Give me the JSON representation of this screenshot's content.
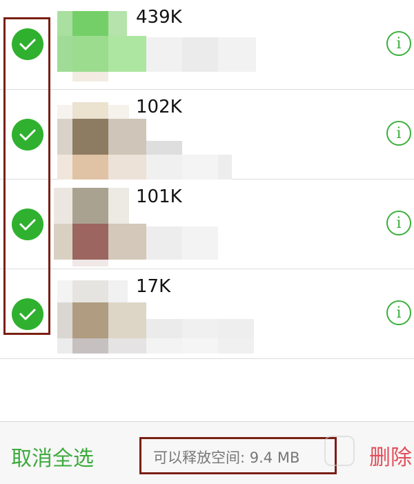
{
  "items": [
    {
      "size": "439K",
      "checked": true
    },
    {
      "size": "102K",
      "checked": true
    },
    {
      "size": "101K",
      "checked": true
    },
    {
      "size": "17K",
      "checked": true
    }
  ],
  "footer": {
    "cancel_select_all": "取消全选",
    "free_space_text": "可以释放空间: 9.4 MB",
    "delete": "删除"
  },
  "icons": {
    "check": "check-circle-icon",
    "info": "info-icon"
  },
  "colors": {
    "green": "#2fb12f",
    "red": "#e34f5a",
    "annotation": "#7a1f14"
  }
}
